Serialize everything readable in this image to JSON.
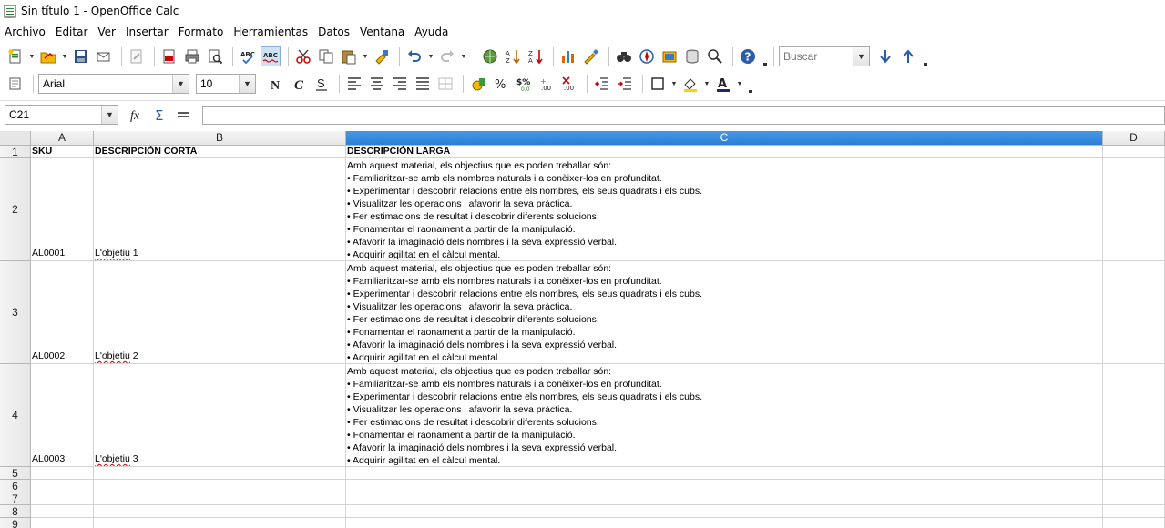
{
  "window": {
    "title": "Sin título 1 - OpenOffice Calc"
  },
  "menu": [
    "Archivo",
    "Editar",
    "Ver",
    "Insertar",
    "Formato",
    "Herramientas",
    "Datos",
    "Ventana",
    "Ayuda"
  ],
  "toolbar": {
    "search_placeholder": "Buscar",
    "font_name": "Arial",
    "font_size": "10"
  },
  "formula": {
    "name_box": "C21",
    "content": ""
  },
  "columns": [
    "A",
    "B",
    "C",
    "D"
  ],
  "selected_column": "C",
  "rows": [
    "1",
    "2",
    "3",
    "4",
    "5",
    "6",
    "7",
    "8",
    "9"
  ],
  "header": {
    "a": "SKU",
    "b": "DESCRIPCIÓN CORTA",
    "c": "DESCRIPCIÓN LARGA"
  },
  "records": [
    {
      "sku": "AL0001",
      "short_a": "L'objetiu",
      "short_b": " 1",
      "long_lines": [
        "Amb aquest material, els objectius que es poden treballar són:",
        "• Familiaritzar-se amb els nombres naturals i a conèixer-los en profunditat.",
        "• Experimentar i descobrir relacions entre els nombres, els seus quadrats i els cubs.",
        "• Visualitzar les operacions i afavorir la seva pràctica.",
        "• Fer estimacions de resultat i descobrir diferents solucions.",
        "• Fonamentar el raonament a partir de la manipulació.",
        "• Afavorir la imaginació dels nombres i la seva expressió verbal.",
        "• Adquirir agilitat en el càlcul mental."
      ]
    },
    {
      "sku": "AL0002",
      "short_a": "L'objetiu",
      "short_b": " 2",
      "long_lines": [
        "Amb aquest material, els objectius que es poden treballar són:",
        "• Familiaritzar-se amb els nombres naturals i a conèixer-los en profunditat.",
        "• Experimentar i descobrir relacions entre els nombres, els seus quadrats i els cubs.",
        "• Visualitzar les operacions i afavorir la seva pràctica.",
        "• Fer estimacions de resultat i descobrir diferents solucions.",
        "• Fonamentar el raonament a partir de la manipulació.",
        "• Afavorir la imaginació dels nombres i la seva expressió verbal.",
        "• Adquirir agilitat en el càlcul mental."
      ]
    },
    {
      "sku": "AL0003",
      "short_a": "L'objetiu",
      "short_b": " 3",
      "long_lines": [
        "Amb aquest material, els objectius que es poden treballar són:",
        "• Familiaritzar-se amb els nombres naturals i a conèixer-los en profunditat.",
        "• Experimentar i descobrir relacions entre els nombres, els seus quadrats i els cubs.",
        "• Visualitzar les operacions i afavorir la seva pràctica.",
        "• Fer estimacions de resultat i descobrir diferents solucions.",
        "• Fonamentar el raonament a partir de la manipulació.",
        "• Afavorir la imaginació dels nombres i la seva expressió verbal.",
        "• Adquirir agilitat en el càlcul mental."
      ]
    }
  ],
  "colors": {
    "selected_header": "#2b7fd4",
    "spellcheck": "#d00000",
    "grid": "#d3d3d3"
  }
}
